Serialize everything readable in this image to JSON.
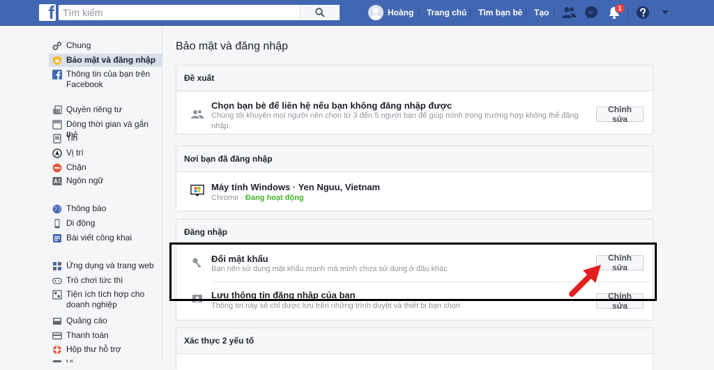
{
  "topbar": {
    "logo_letter": "f",
    "search_placeholder": "Tìm kiếm",
    "user_name": "Hoàng",
    "nav": [
      "Trang chủ",
      "Tìm bạn bè",
      "Tạo"
    ],
    "notification_count": "1"
  },
  "sidebar": {
    "items": [
      {
        "label": "Chung",
        "icon": "gear-icon"
      },
      {
        "label": "Bảo mật và đăng nhập",
        "icon": "shield-icon"
      },
      {
        "label": "Thông tin của bạn trên Facebook",
        "icon": "facebook-icon"
      },
      {
        "label": "Quyền riêng tư",
        "icon": "lock-icon"
      },
      {
        "label": "Dòng thời gian và gắn thẻ",
        "icon": "timeline-icon"
      },
      {
        "label": "Tin",
        "icon": "story-icon"
      },
      {
        "label": "Vị trí",
        "icon": "location-icon"
      },
      {
        "label": "Chặn",
        "icon": "block-icon"
      },
      {
        "label": "Ngôn ngữ",
        "icon": "language-icon"
      },
      {
        "label": "Thông báo",
        "icon": "globe-icon"
      },
      {
        "label": "Di động",
        "icon": "mobile-icon"
      },
      {
        "label": "Bài viết công khai",
        "icon": "public-post-icon"
      },
      {
        "label": "Ứng dụng và trang web",
        "icon": "apps-icon"
      },
      {
        "label": "Trò chơi tức thì",
        "icon": "game-icon"
      },
      {
        "label": "Tiện ích tích hợp cho doanh nghiệp",
        "icon": "business-icon"
      },
      {
        "label": "Quảng cáo",
        "icon": "ads-icon"
      },
      {
        "label": "Thanh toán",
        "icon": "payment-icon"
      },
      {
        "label": "Hộp thư hỗ trợ",
        "icon": "support-icon"
      },
      {
        "label": "Vi",
        "icon": "video-icon"
      }
    ],
    "active_index": 1
  },
  "main": {
    "title": "Bảo mật và đăng nhập",
    "sections": [
      {
        "header": "Đề xuất",
        "rows": [
          {
            "title": "Chọn bạn bè để liên hệ nếu bạn không đăng nhập được",
            "desc": "Chúng tôi khuyên mọi người nên chọn từ 3 đến 5 người bạn để giúp mình trong trường hợp không thể đăng nhập.",
            "button": "Chỉnh sửa",
            "icon": "friends-icon"
          }
        ]
      },
      {
        "header": "Nơi bạn đã đăng nhập",
        "rows": [
          {
            "title": "Máy tính Windows · Yen Nguu, Vietnam",
            "browser": "Chrome",
            "dot": "·",
            "status": "Đang hoạt động",
            "icon": "windows-icon"
          }
        ]
      },
      {
        "header": "Đăng nhập",
        "rows": [
          {
            "title": "Đổi mật khẩu",
            "desc": "Bạn nên sử dụng mật khẩu mạnh mà mình chưa sử dụng ở đâu khác",
            "button": "Chỉnh sửa",
            "icon": "key-icon"
          },
          {
            "title": "Lưu thông tin đăng nhập của bạn",
            "desc": "Thông tin này sẽ chỉ được lưu trên những trình duyệt và thiết bị bạn chọn",
            "button": "Chỉnh sửa",
            "icon": "save-login-icon"
          }
        ]
      },
      {
        "header": "Xác thực 2 yếu tố",
        "rows": []
      }
    ]
  },
  "colors": {
    "brand": "#4267b2",
    "active_green": "#42b72a",
    "annotation_arrow": "#e41e1e"
  }
}
